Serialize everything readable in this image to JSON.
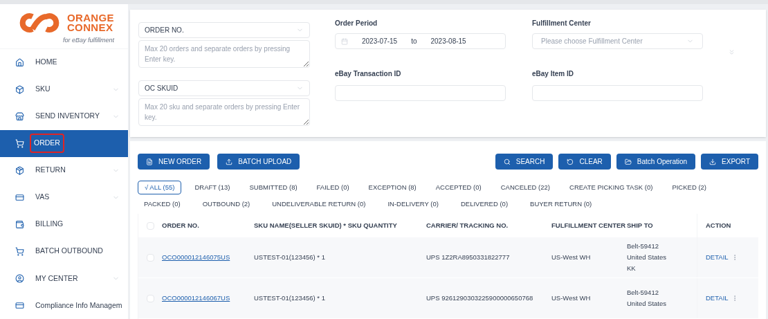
{
  "logo": {
    "line1": "ORANGE",
    "line2": "CONNEX",
    "tagline": "for eBay fulfillment"
  },
  "sidebar": {
    "items": [
      {
        "label": "HOME",
        "expandable": false,
        "selected": false,
        "outlined": false
      },
      {
        "label": "SKU",
        "expandable": true,
        "selected": false,
        "outlined": false
      },
      {
        "label": "SEND INVENTORY",
        "expandable": true,
        "selected": false,
        "outlined": false
      },
      {
        "label": "ORDER",
        "expandable": false,
        "selected": true,
        "outlined": true
      },
      {
        "label": "RETURN",
        "expandable": true,
        "selected": false,
        "outlined": false
      },
      {
        "label": "VAS",
        "expandable": true,
        "selected": false,
        "outlined": false
      },
      {
        "label": "BILLING",
        "expandable": false,
        "selected": false,
        "outlined": false
      },
      {
        "label": "BATCH OUTBOUND",
        "expandable": false,
        "selected": false,
        "outlined": false
      },
      {
        "label": "MY CENTER",
        "expandable": true,
        "selected": false,
        "outlined": false
      },
      {
        "label": "Compliance Info Managem",
        "selected": false,
        "outlined": false
      }
    ]
  },
  "filters": {
    "order_no": {
      "select": "ORDER NO.",
      "placeholder": "Max 20 orders and separate orders by pressing Enter key."
    },
    "skuid": {
      "select": "OC SKUID",
      "placeholder": "Max 20 sku and separate orders by pressing Enter key."
    },
    "order_period": {
      "label": "Order Period",
      "start": "2023-07-15",
      "separator": "to",
      "end": "2023-08-15"
    },
    "fulfillment_center": {
      "label": "Fulfillment Center",
      "placeholder": "Please choose Fulfillment Center"
    },
    "transaction_id": {
      "label": "eBay Transaction ID"
    },
    "item_id": {
      "label": "eBay Item ID"
    }
  },
  "actions_left": [
    {
      "label": "NEW ORDER"
    },
    {
      "label": "BATCH UPLOAD"
    }
  ],
  "actions_right": [
    {
      "label": "SEARCH"
    },
    {
      "label": "CLEAR"
    },
    {
      "label": "Batch Operation"
    },
    {
      "label": "EXPORT"
    }
  ],
  "status_tabs": [
    {
      "label": "√ ALL (55)",
      "selected": true
    },
    {
      "label": "DRAFT (13)",
      "selected": false
    },
    {
      "label": "SUBMITTED (8)",
      "selected": false
    },
    {
      "label": "FAILED (0)",
      "selected": false
    },
    {
      "label": "EXCEPTION (8)",
      "selected": false
    },
    {
      "label": "ACCEPTED (0)",
      "selected": false
    },
    {
      "label": "CANCELED (22)",
      "selected": false
    },
    {
      "label": "CREATE PICKING TASK (0)",
      "selected": false
    },
    {
      "label": "PICKED (2)",
      "selected": false
    },
    {
      "label": "PACKED (0)",
      "selected": false
    },
    {
      "label": "OUTBOUND (2)",
      "selected": false
    },
    {
      "label": "UNDELIVERABLE RETURN (0)",
      "selected": false
    },
    {
      "label": "IN-DELIVERY (0)",
      "selected": false
    },
    {
      "label": "DELIVERED (0)",
      "selected": false
    },
    {
      "label": "BUYER RETURN (0)",
      "selected": false
    }
  ],
  "table": {
    "all_checked": false,
    "columns": [
      "ORDER NO.",
      "SKU NAME(SELLER SKUID) * SKU QUANTITY",
      "CARRIER/ TRACKING NO.",
      "FULFILLMENT CENTER",
      "SHIP TO",
      "ACTION"
    ],
    "rows": [
      {
        "checked": false,
        "order_no": "OCO000012146075US",
        "sku": "USTEST-01(123456) * 1",
        "tracking": "UPS 1Z2RA8950331822777",
        "center": "US-West WH",
        "ship_to": [
          "Belt-59412",
          "United States",
          "KK"
        ],
        "action": "DETAIL"
      },
      {
        "checked": false,
        "order_no": "OCO000012146067US",
        "sku": "USTEST-01(123456) * 1",
        "tracking": "UPS 9261290303225900000650768",
        "center": "US-West WH",
        "ship_to": [
          "Belt-59412",
          "United States"
        ],
        "action": "DETAIL"
      }
    ]
  }
}
